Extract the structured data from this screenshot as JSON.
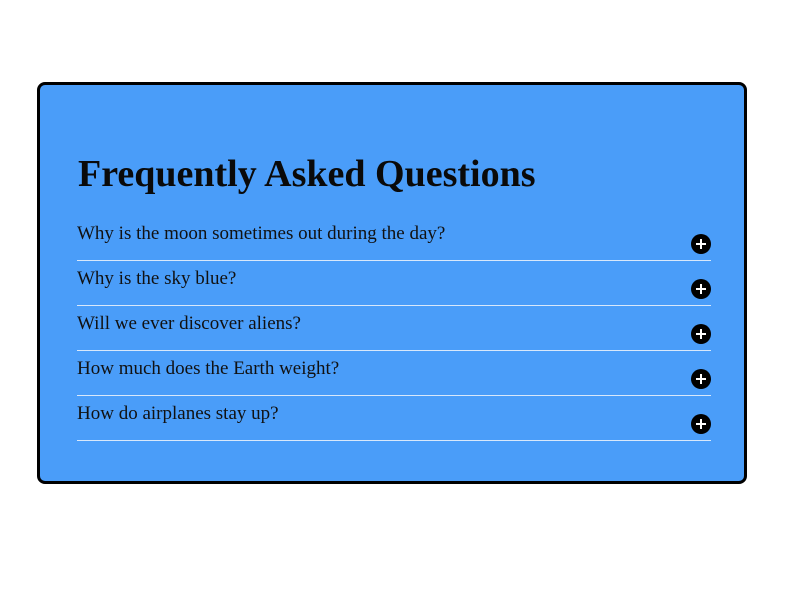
{
  "faq": {
    "title": "Frequently Asked Questions",
    "items": [
      {
        "question": "Why is the moon sometimes out during the day?",
        "icon": "plus-circle-icon",
        "expanded": false
      },
      {
        "question": "Why is the sky blue?",
        "icon": "plus-circle-icon",
        "expanded": false
      },
      {
        "question": "Will we ever discover aliens?",
        "icon": "plus-circle-icon",
        "expanded": false
      },
      {
        "question": "How much does the Earth weight?",
        "icon": "plus-circle-icon",
        "expanded": false
      },
      {
        "question": "How do airplanes stay up?",
        "icon": "plus-circle-icon",
        "expanded": false
      }
    ]
  },
  "colors": {
    "card_background": "#4a9df9",
    "card_border": "#000000",
    "divider": "#d8e8fb",
    "icon": "#000000"
  }
}
